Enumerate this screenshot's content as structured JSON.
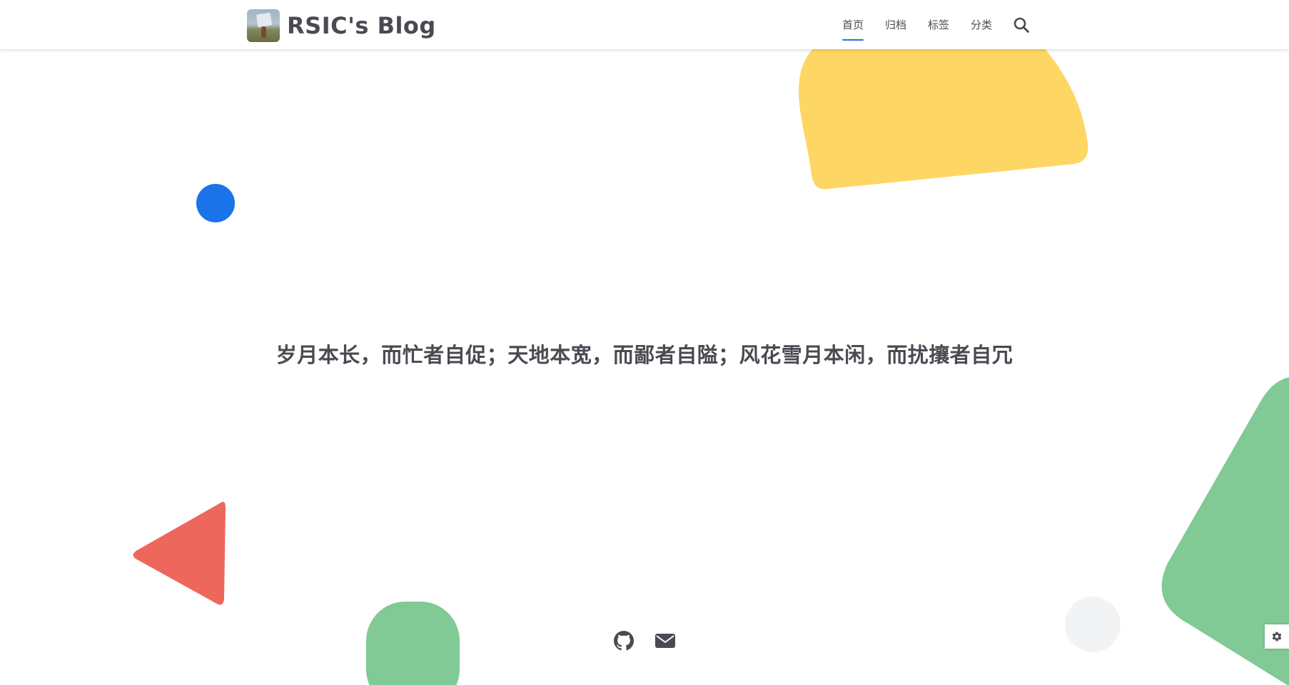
{
  "header": {
    "site_title": "RSIC's Blog",
    "nav": [
      {
        "label": "首页",
        "active": true
      },
      {
        "label": "归档",
        "active": false
      },
      {
        "label": "标签",
        "active": false
      },
      {
        "label": "分类",
        "active": false
      }
    ],
    "search_icon": "search-icon",
    "accent_color": "#2a6dd8"
  },
  "hero": {
    "quote": "岁月本长，而忙者自促；天地本宽，而鄙者自隘；风花雪月本闲，而扰攘者自冗"
  },
  "social": {
    "icons": [
      "github-icon",
      "email-icon"
    ]
  },
  "settings": {
    "icon": "gear-icon"
  },
  "colors": {
    "text": "#4a4a52",
    "yellow": "#fdd663",
    "blue": "#1a73e8",
    "red": "#ee675c",
    "green": "#81c995",
    "grey": "#f1f3f4"
  }
}
